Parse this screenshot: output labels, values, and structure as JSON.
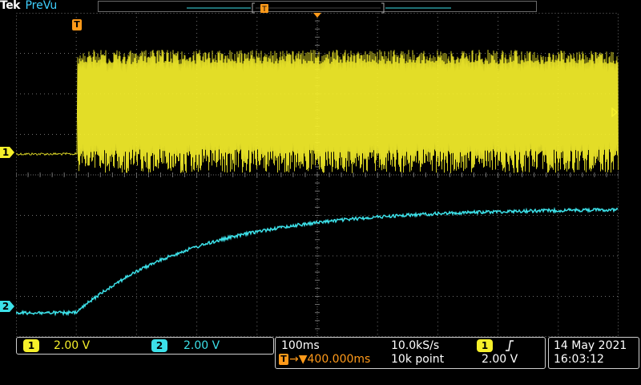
{
  "header": {
    "brand": "Tek",
    "status": "PreVu",
    "trigger_indicator": "T"
  },
  "colors": {
    "ch1": "#f6f02a",
    "ch2": "#3ce0e8",
    "trigger": "#ff9a1a",
    "grid": "#6f6f6f"
  },
  "markers": {
    "ch1_label": "1",
    "ch2_label": "2",
    "trigger_label": "T"
  },
  "channels": {
    "ch1": {
      "number": "1",
      "scale": "2.00 V"
    },
    "ch2": {
      "number": "2",
      "scale": "2.00 V"
    }
  },
  "horizontal": {
    "time_per_div": "100ms",
    "sample_rate": "10.0kS/s",
    "trigger_position": "▼400.000ms",
    "record_length": "10k point",
    "trigger_source": "1",
    "trigger_slope_icon": "rising-edge-icon",
    "trigger_level": "2.00 V"
  },
  "datetime": {
    "date": "14 May 2021",
    "time": "16:03:12"
  }
}
